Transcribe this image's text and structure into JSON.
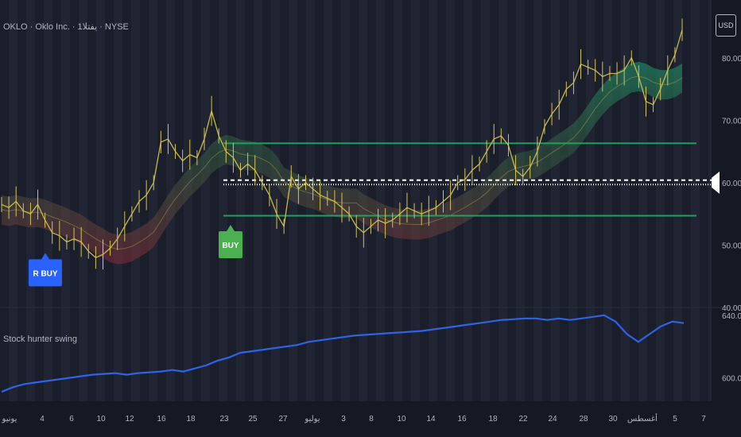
{
  "header": {
    "title": "OKLO · Oklo Inc. · 1يفتلا · NYSE",
    "currency": "USD"
  },
  "indicator": {
    "name": "Stock hunter swing"
  },
  "markers": [
    {
      "label": "R BUY",
      "x_label_index": 1,
      "price": 49.5,
      "color": "#2962ff"
    },
    {
      "label": "BUY",
      "x_label_index": 6,
      "price": 54.0,
      "color": "#4caf50"
    }
  ],
  "levels": {
    "upper_resistance": 66.3,
    "current_price_line": 60.0,
    "support": 54.7
  },
  "chart_data": [
    {
      "type": "line",
      "title": "OKLO · Oklo Inc. · 1يفتلا · NYSE",
      "xlabel": "",
      "ylabel": "USD",
      "x_ticks": [
        "يونيو",
        "4",
        "6",
        "10",
        "12",
        "16",
        "18",
        "23",
        "25",
        "27",
        "يوليو",
        "3",
        "8",
        "10",
        "14",
        "16",
        "18",
        "22",
        "24",
        "28",
        "30",
        "أغسطس",
        "5",
        "7"
      ],
      "y_ticks": [
        "80.00",
        "70.00",
        "60.00",
        "50.00",
        "40.00"
      ],
      "ylim": [
        40,
        88
      ],
      "series": [
        {
          "values": [
            56.5,
            56,
            57,
            55.5,
            55,
            56.5,
            54,
            52,
            51.5,
            50.5,
            51,
            50.5,
            49,
            48,
            48.5,
            49.5,
            51,
            53,
            55,
            57,
            58,
            60,
            66.5,
            67,
            65,
            63.5,
            64.5,
            64,
            67,
            71.5,
            67.5,
            65,
            64,
            62,
            63,
            62,
            60,
            58,
            55,
            53,
            61,
            59,
            60,
            59,
            58,
            57.5,
            57,
            56,
            55,
            53,
            52,
            53,
            54,
            53.5,
            54,
            55,
            56,
            55.5,
            55,
            55.5,
            56,
            57,
            58,
            60,
            60.5,
            62,
            63,
            65,
            67,
            67.5,
            66,
            62,
            61,
            62.5,
            65,
            69,
            71,
            72.5,
            75,
            76,
            79,
            78.5,
            78,
            77,
            77.5,
            77.5,
            78,
            80,
            77,
            73,
            72.5,
            75,
            78,
            80.5,
            84.5
          ]
        }
      ]
    },
    {
      "type": "line",
      "title": "Stock hunter swing",
      "ylim": [
        585,
        645
      ],
      "y_ticks": [
        "640.00",
        "600.00"
      ],
      "series": [
        {
          "values": [
            591,
            594,
            596,
            597,
            598,
            599,
            600,
            601,
            602,
            602.5,
            603,
            602,
            603,
            603.5,
            604,
            605,
            604,
            606,
            608,
            611,
            613,
            616,
            617,
            618,
            619,
            620,
            621,
            623,
            624,
            625,
            626,
            627,
            627.5,
            628,
            628.5,
            629,
            629.5,
            630,
            631,
            632,
            633,
            634,
            635,
            636,
            637,
            637.5,
            638,
            638,
            637,
            638,
            637,
            638,
            639,
            640,
            636,
            628,
            623,
            628,
            633,
            636,
            635
          ]
        }
      ]
    }
  ]
}
